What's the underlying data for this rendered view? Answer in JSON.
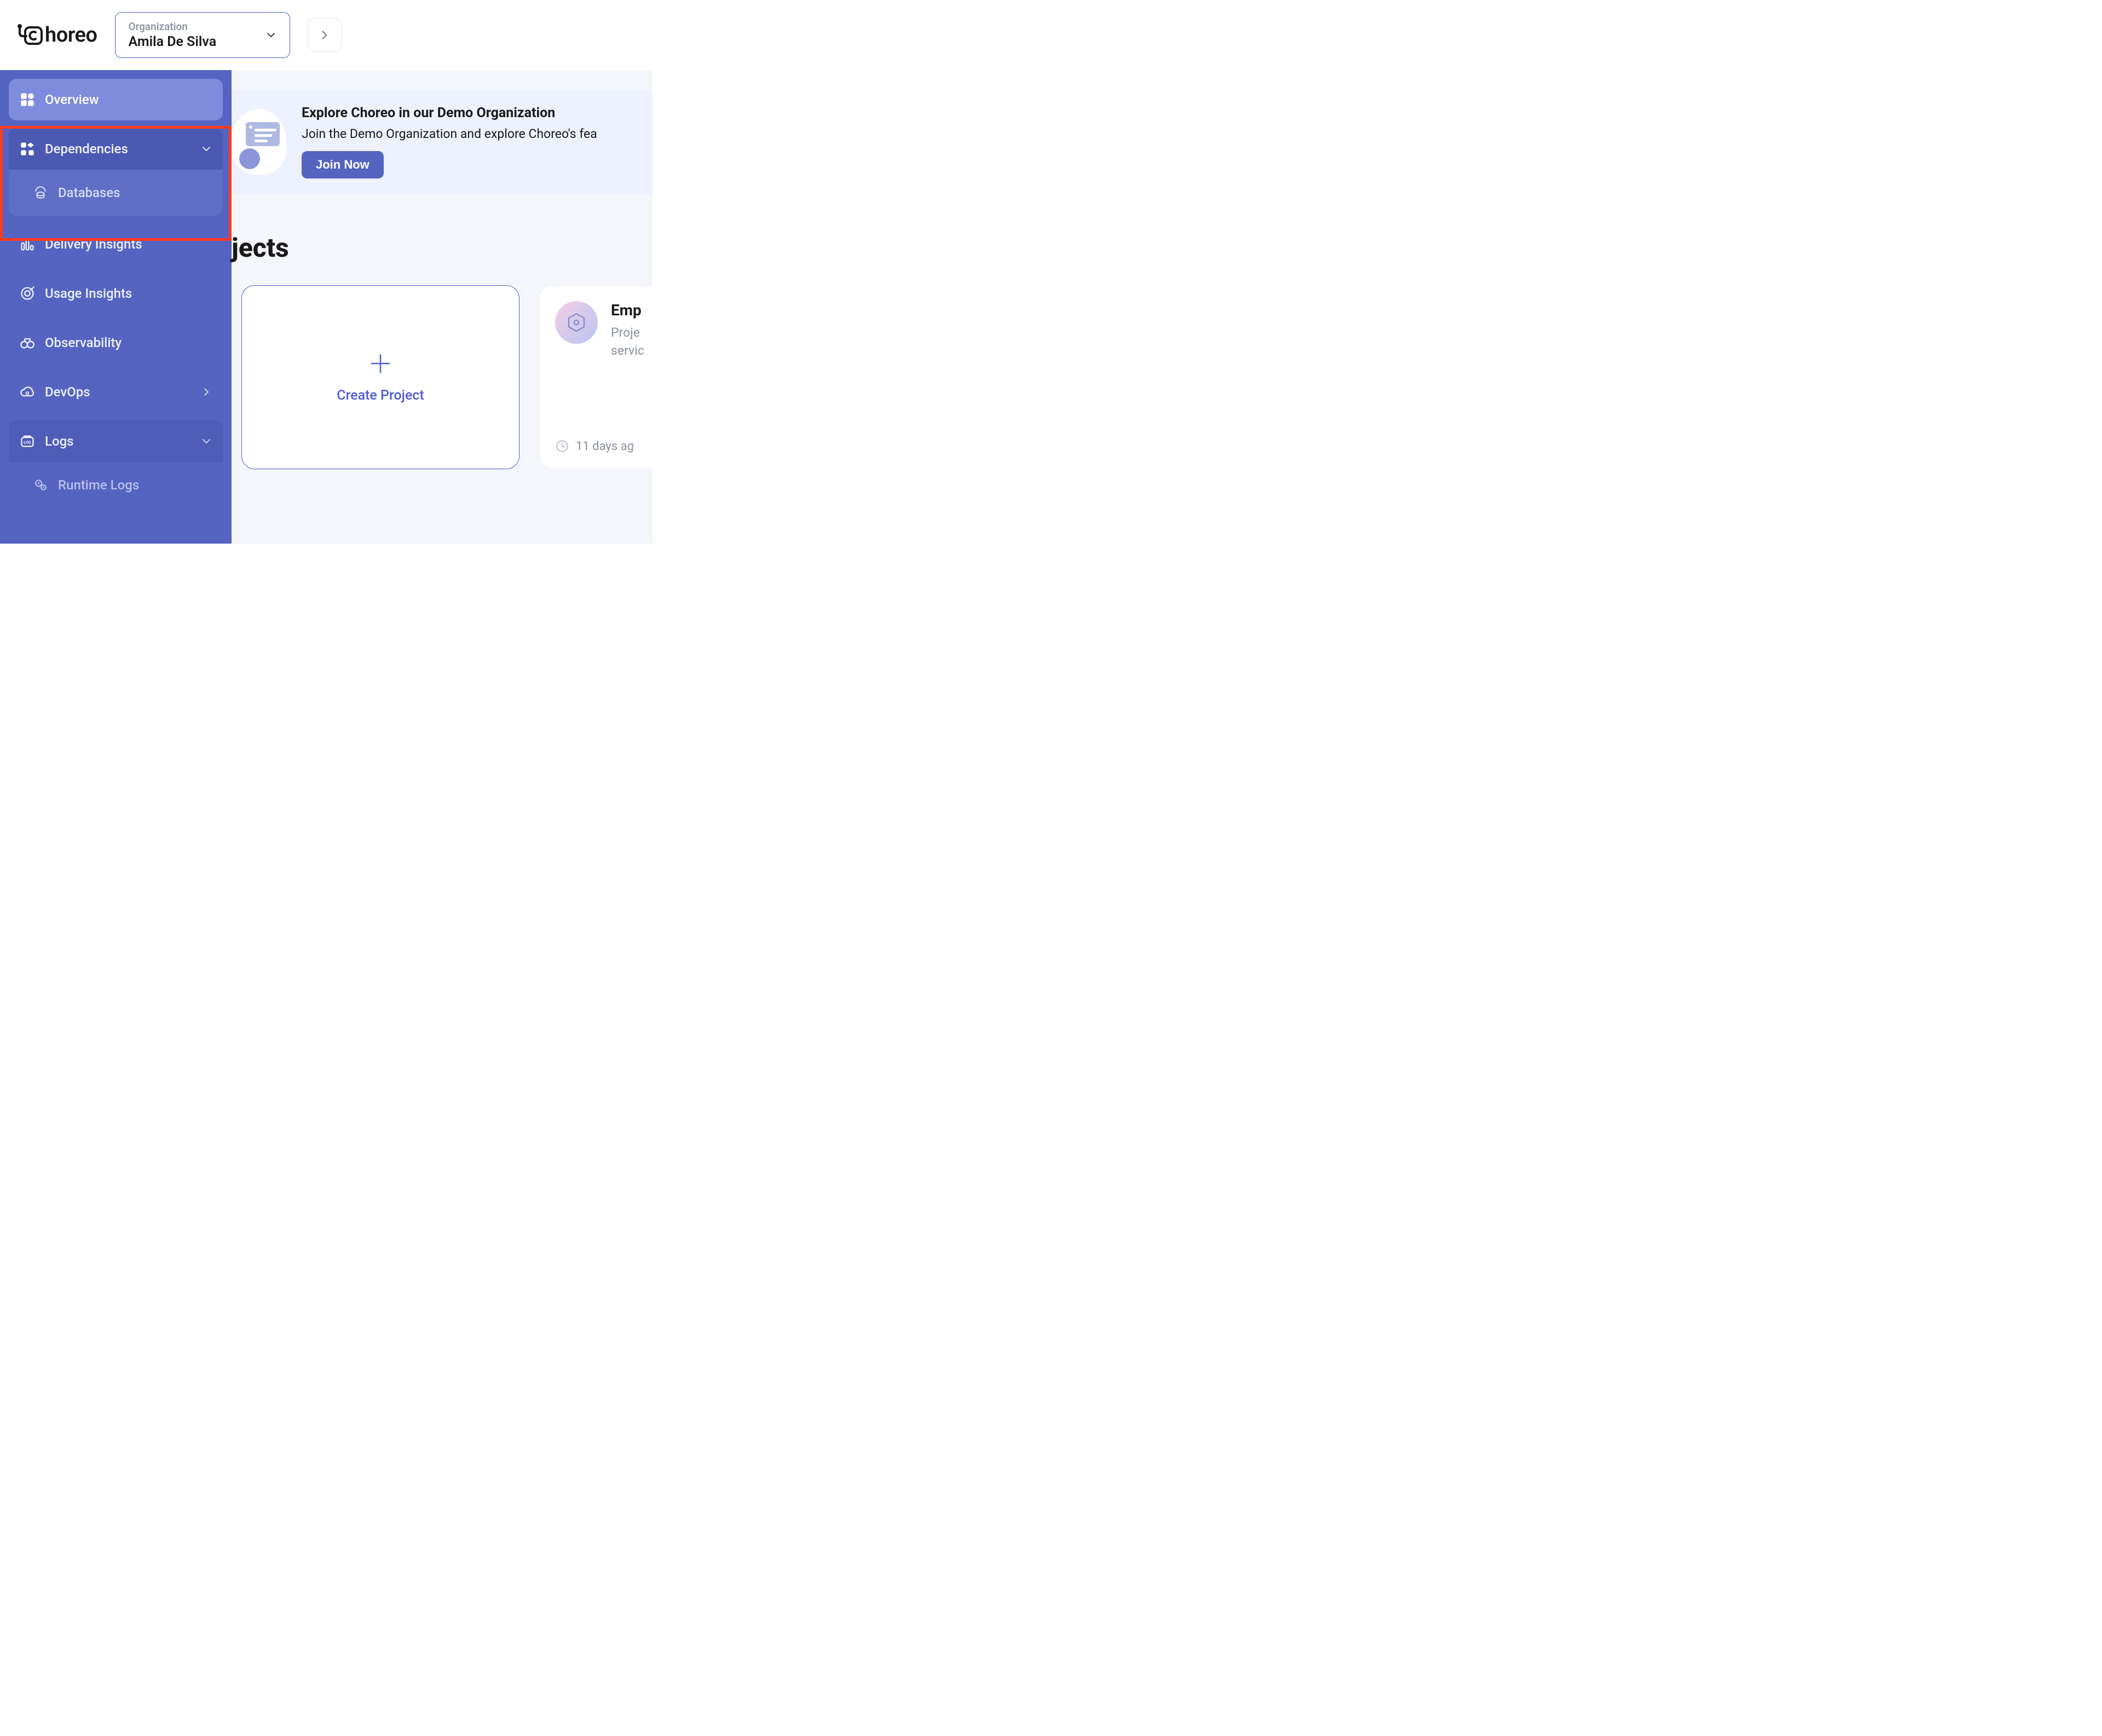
{
  "brand": {
    "name": "horeo"
  },
  "org_picker": {
    "label": "Organization",
    "value": "Amila De Silva"
  },
  "sidebar": {
    "overview": "Overview",
    "dependencies": "Dependencies",
    "databases": "Databases",
    "delivery": "Delivery Insights",
    "usage": "Usage Insights",
    "observability": "Observability",
    "devops": "DevOps",
    "logs": "Logs",
    "runtime_logs": "Runtime Logs"
  },
  "banner": {
    "title": "Explore Choreo in our Demo Organization",
    "subtitle": "Join the Demo Organization and explore Choreo's fea",
    "cta": "Join Now"
  },
  "main": {
    "section_title_fragment": "jects",
    "create_label": "Create Project",
    "project": {
      "name_fragment": "Emp",
      "desc_line1": "Proje",
      "desc_line2": "servic",
      "age": "11 days ag"
    }
  }
}
